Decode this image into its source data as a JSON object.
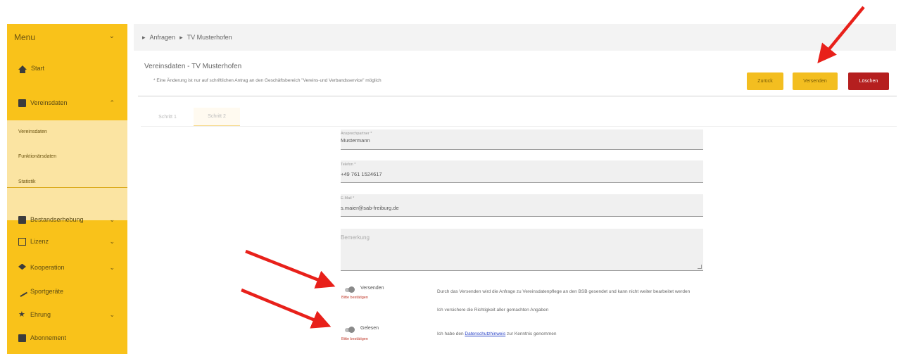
{
  "sidebar": {
    "title": "Menu",
    "items": [
      {
        "label": "Start",
        "icon": "home-icon"
      },
      {
        "label": "Vereinsdaten",
        "icon": "grid-icon"
      },
      {
        "label": "Bestandserhebung",
        "icon": "list-icon"
      },
      {
        "label": "Lizenz",
        "icon": "license-icon"
      },
      {
        "label": "Kooperation",
        "icon": "cap-icon"
      },
      {
        "label": "Sportgeräte",
        "icon": "equipment-icon"
      },
      {
        "label": "Ehrung",
        "icon": "star-icon"
      },
      {
        "label": "Abonnement",
        "icon": "subscription-icon"
      }
    ],
    "subitems": [
      "Vereinsdaten",
      "Funktionärsdaten",
      "Statistik"
    ]
  },
  "breadcrumb": {
    "items": [
      "Anfragen",
      "TV Musterhofen"
    ]
  },
  "header": {
    "title": "Vereinsdaten - TV Musterhofen",
    "note": "* Eine Änderung ist nur auf schriftlichen Antrag an den Geschäftsbereich \"Vereins-und Verbandsservice\" möglich",
    "buttons": {
      "back": "Zurück",
      "send": "Versenden",
      "delete": "Löschen"
    }
  },
  "tabs": [
    "Schritt 1",
    "Schritt 2"
  ],
  "form": {
    "fields": [
      {
        "label": "Ansprechpartner *",
        "value": "Mustermann"
      },
      {
        "label": "Telefon *",
        "value": "+49 761 1524617"
      },
      {
        "label": "E-Mail *",
        "value": "s.maier@sab-freiburg.de"
      }
    ],
    "remark_label": "Bemerkung"
  },
  "toggles": {
    "send": {
      "label": "Versenden",
      "error": "Bitte bestätigen"
    },
    "read": {
      "label": "Gelesen",
      "error": "Bitte bestätigen"
    }
  },
  "descriptions": {
    "send": "Durch das Versenden wird die Anfrage zu Vereinsdatenpflege an den BSB gesendet und kann nicht weiter bearbeitet werden",
    "confirm": "Ich versichere die Richtigkeit aller gemachten Angaben",
    "read_prefix": "Ich habe den",
    "read_link": "Datenschutzhinweis",
    "read_suffix": "zur Kenntnis genommen"
  },
  "colors": {
    "accent": "#f9c21a",
    "danger": "#b51f1f",
    "annotation": "#e8201a"
  }
}
